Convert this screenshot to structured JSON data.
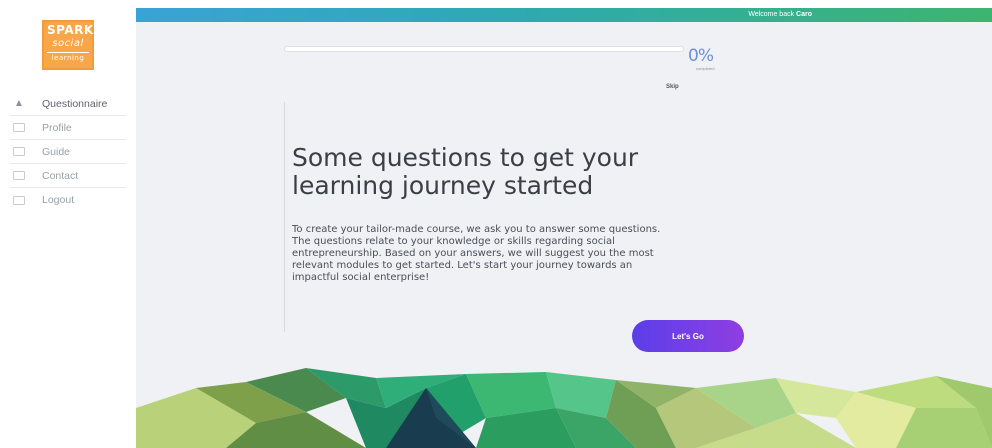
{
  "logo": {
    "line1": "SPARK",
    "line2": "social",
    "line3": "learning"
  },
  "sidebar": {
    "items": [
      {
        "label": "Questionnaire",
        "icon": "warning-triangle-icon",
        "active": true
      },
      {
        "label": "Profile",
        "icon": "profile-icon",
        "active": false
      },
      {
        "label": "Guide",
        "icon": "guide-icon",
        "active": false
      },
      {
        "label": "Contact",
        "icon": "contact-icon",
        "active": false
      },
      {
        "label": "Logout",
        "icon": "logout-icon",
        "active": false
      }
    ]
  },
  "topbar": {
    "welcome_prefix": "Welcome back",
    "username": "Caro"
  },
  "progress": {
    "percent_label": "0%",
    "percent_value": 0,
    "sub_label": "completed",
    "skip_label": "Skip"
  },
  "main": {
    "headline": "Some questions to get your learning journey started",
    "intro": "To create your tailor-made course, we ask you to answer some questions. The questions relate to your knowledge or skills regarding social entrepreneurship. Based on your answers, we will suggest you the most relevant modules to get started. Let's start your journey towards an impactful social enterprise!",
    "cta_label": "Let's Go"
  },
  "colors": {
    "accent": "#6d3fe4",
    "topbar_start": "#3aa3d6",
    "topbar_end": "#3cb570",
    "logo": "#f7a64a"
  }
}
